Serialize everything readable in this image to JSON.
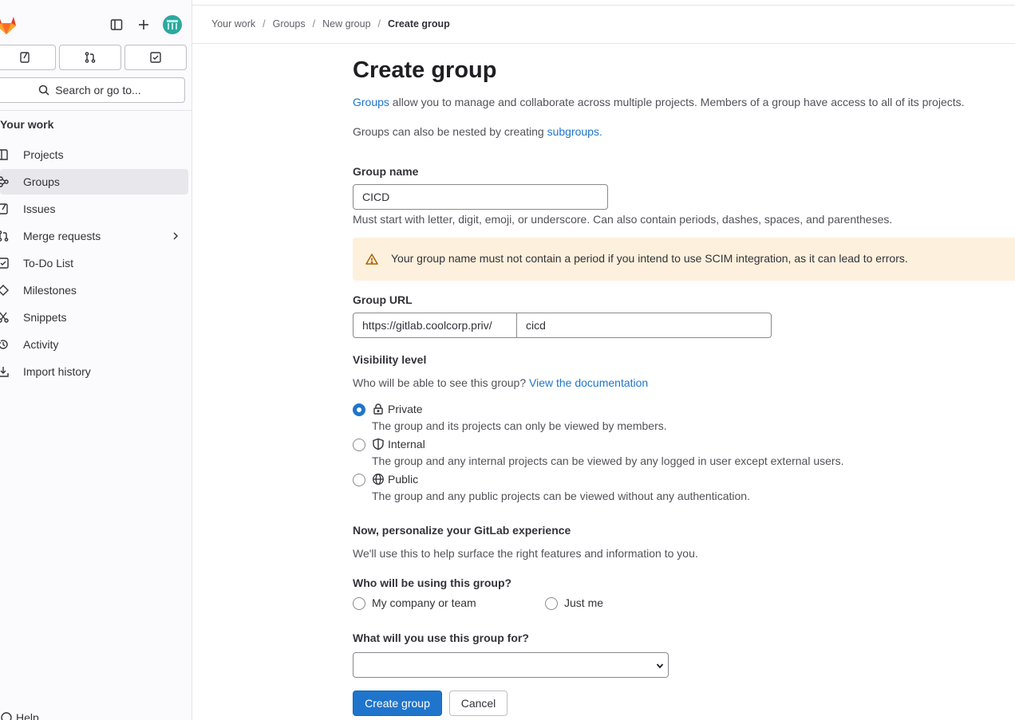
{
  "sidebar": {
    "new_label": "+",
    "search_label": "Search or go to...",
    "section_title": "Your work",
    "items": [
      {
        "label": "Projects",
        "icon": "project-icon"
      },
      {
        "label": "Groups",
        "icon": "group-icon",
        "active": true
      },
      {
        "label": "Issues",
        "icon": "issues-icon"
      },
      {
        "label": "Merge requests",
        "icon": "merge-request-icon"
      },
      {
        "label": "To-Do List",
        "icon": "todo-icon"
      },
      {
        "label": "Milestones",
        "icon": "milestone-icon"
      },
      {
        "label": "Snippets",
        "icon": "snippet-icon"
      },
      {
        "label": "Activity",
        "icon": "history-icon"
      },
      {
        "label": "Import history",
        "icon": "import-icon"
      }
    ],
    "help_label": "Help"
  },
  "breadcrumb": {
    "items": [
      "Your work",
      "Groups",
      "New group",
      "Create group"
    ],
    "separator": "/"
  },
  "page": {
    "title": "Create group",
    "intro_link": "Groups",
    "intro_rest": " allow you to manage and collaborate across multiple projects. Members of a group have access to all of its projects.",
    "nested_text": "Groups can also be nested by creating ",
    "nested_link": "subgroups",
    "nested_end": "."
  },
  "form": {
    "group_name_label": "Group name",
    "group_name_value": "CICD",
    "group_name_help": "Must start with letter, digit, emoji, or underscore. Can also contain periods, dashes, spaces, and parentheses.",
    "alert_text": "Your group name must not contain a period if you intend to use SCIM integration, as it can lead to errors.",
    "group_url_label": "Group URL",
    "group_url_prefix": "https://gitlab.coolcorp.priv/",
    "group_url_value": "cicd",
    "visibility_label": "Visibility level",
    "visibility_question": "Who will be able to see this group? ",
    "visibility_doc_link": "View the documentation",
    "visibility_options": [
      {
        "label": "Private",
        "icon": "lock-icon",
        "desc": "The group and its projects can only be viewed by members.",
        "checked": true
      },
      {
        "label": "Internal",
        "icon": "shield-icon",
        "desc": "The group and any internal projects can be viewed by any logged in user except external users.",
        "checked": false
      },
      {
        "label": "Public",
        "icon": "globe-icon",
        "desc": "The group and any public projects can be viewed without any authentication.",
        "checked": false
      }
    ],
    "personalize_title": "Now, personalize your GitLab experience",
    "personalize_desc": "We'll use this to help surface the right features and information to you.",
    "who_label": "Who will be using this group?",
    "who_options": [
      "My company or team",
      "Just me"
    ],
    "use_label": "What will you use this group for?",
    "use_value": "",
    "create_button": "Create group",
    "cancel_button": "Cancel"
  },
  "colors": {
    "accent": "#1f75cb",
    "alert_bg": "#fdf1dd",
    "alert_icon": "#ab6100",
    "sidebar_bg": "#fbfafd"
  }
}
